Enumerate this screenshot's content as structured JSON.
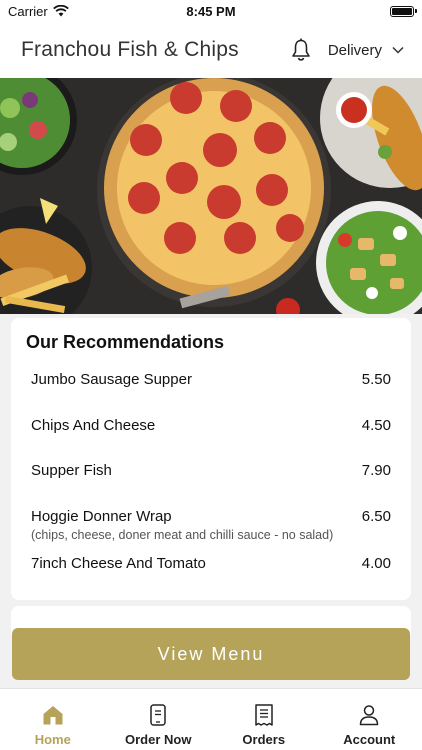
{
  "status": {
    "carrier": "Carrier",
    "time": "8:45 PM"
  },
  "header": {
    "title": "Franchou Fish & Chips",
    "delivery_label": "Delivery"
  },
  "recommendations": {
    "title": "Our Recommendations",
    "items": [
      {
        "name": "Jumbo Sausage Supper",
        "price": "5.50",
        "description": ""
      },
      {
        "name": "Chips And Cheese",
        "price": "4.50",
        "description": ""
      },
      {
        "name": "Supper Fish",
        "price": "7.90",
        "description": ""
      },
      {
        "name": "Hoggie Donner Wrap",
        "price": "6.50",
        "description": "(chips, cheese, doner meat and chilli sauce - no salad)"
      },
      {
        "name": "7inch Cheese And Tomato",
        "price": "4.00",
        "description": ""
      }
    ]
  },
  "view_menu_label": "View Menu",
  "tabs": [
    {
      "label": "Home",
      "icon": "home-icon",
      "active": true
    },
    {
      "label": "Order Now",
      "icon": "order-icon",
      "active": false
    },
    {
      "label": "Orders",
      "icon": "receipt-icon",
      "active": false
    },
    {
      "label": "Account",
      "icon": "user-icon",
      "active": false
    }
  ],
  "colors": {
    "accent": "#b5a35a",
    "hero_bg": "#2b2b2b"
  }
}
